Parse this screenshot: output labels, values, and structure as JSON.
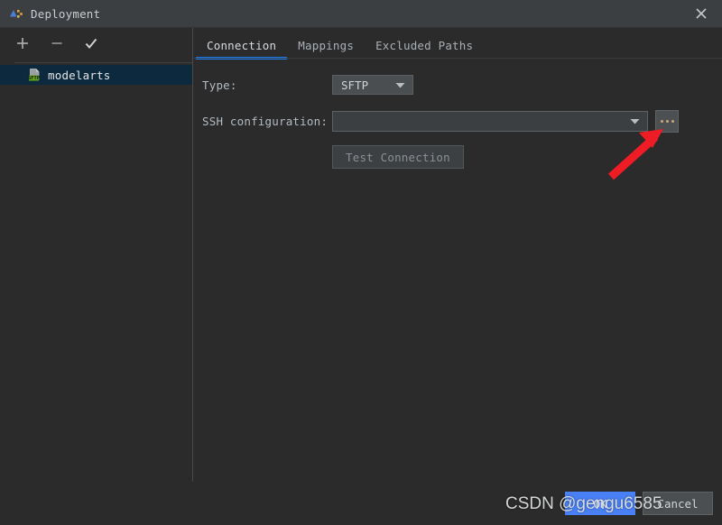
{
  "window": {
    "title": "Deployment",
    "icon": "deployment-icon",
    "close_icon": "close-icon"
  },
  "sidebar": {
    "toolbar": [
      {
        "name": "add-button",
        "icon": "plus-icon"
      },
      {
        "name": "remove-button",
        "icon": "minus-icon"
      },
      {
        "name": "set-default-button",
        "icon": "check-icon"
      }
    ],
    "items": [
      {
        "label": "modelarts",
        "icon": "sftp-file-icon",
        "selected": true
      }
    ]
  },
  "tabs": [
    {
      "label": "Connection",
      "active": true
    },
    {
      "label": "Mappings",
      "active": false
    },
    {
      "label": "Excluded Paths",
      "active": false
    }
  ],
  "form": {
    "type": {
      "label": "Type:",
      "value": "SFTP"
    },
    "ssh_configuration": {
      "label": "SSH configuration:",
      "value": "",
      "browse_label": "...",
      "browse_icon": "ellipsis-icon"
    },
    "test_connection_label": "Test Connection"
  },
  "footer": {
    "ok_label": "OK",
    "cancel_label": "Cancel"
  },
  "annotations": {
    "arrow": "red-arrow-pointing-to-browse-button",
    "watermark": "CSDN @gengu6585"
  },
  "colors": {
    "accent_blue": "#1a7ef0",
    "primary_button": "#4a80f5",
    "selection": "#0d293e",
    "arrow_red": "#ee1c25",
    "window_bg": "#2b2b2b",
    "titlebar_bg": "#3c3f41"
  }
}
